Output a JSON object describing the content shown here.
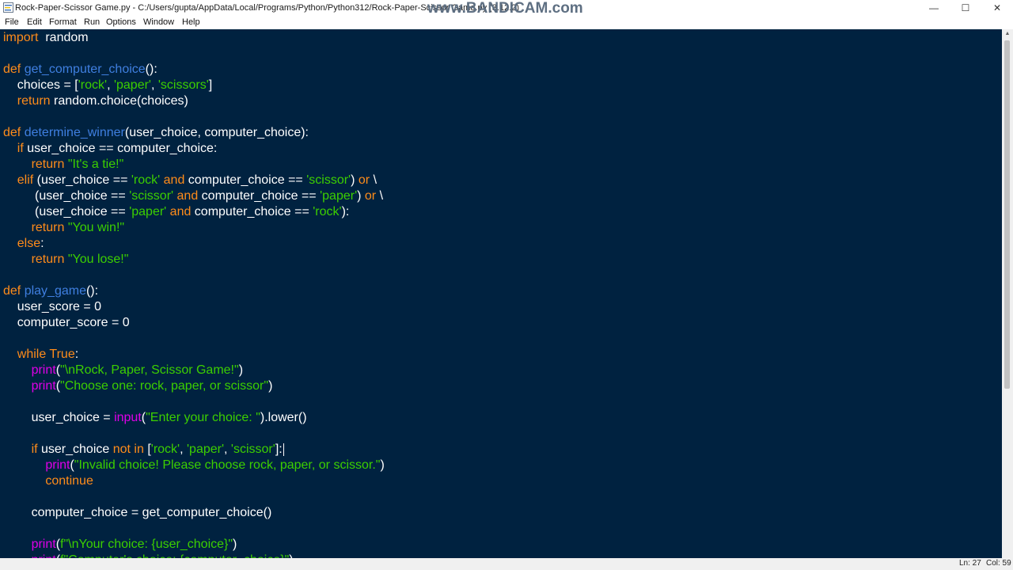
{
  "window": {
    "title": "Rock-Paper-Scissor Game.py - C:/Users/gupta/AppData/Local/Programs/Python/Python312/Rock-Paper-Scissor Game.py (3.12.2)",
    "watermark": "www.BANDICAM.com",
    "minimize_label": "—",
    "maximize_label": "☐",
    "close_label": "✕"
  },
  "menu": {
    "items": [
      {
        "label": "File"
      },
      {
        "label": "Edit"
      },
      {
        "label": "Format"
      },
      {
        "label": "Run"
      },
      {
        "label": "Options"
      },
      {
        "label": "Window"
      },
      {
        "label": "Help"
      }
    ]
  },
  "editor": {
    "colors": {
      "background": "#002240",
      "default": "#ffffff",
      "keyword": "#ff8c1a",
      "definition": "#3f7fe0",
      "string": "#3ccf00",
      "builtin": "#e000e8"
    },
    "lines": [
      [
        [
          "kw",
          "import"
        ],
        [
          "",
          "  random"
        ]
      ],
      [],
      [
        [
          "kw",
          "def "
        ],
        [
          "defn",
          "get_computer_choice"
        ],
        [
          "",
          "():"
        ]
      ],
      [
        [
          "",
          "    choices = ["
        ],
        [
          "str",
          "'rock'"
        ],
        [
          "",
          ", "
        ],
        [
          "str",
          "'paper'"
        ],
        [
          "",
          ", "
        ],
        [
          "str",
          "'scissors'"
        ],
        [
          "",
          "]"
        ]
      ],
      [
        [
          "kw",
          "    return"
        ],
        [
          "",
          " random.choice(choices)"
        ]
      ],
      [],
      [
        [
          "kw",
          "def "
        ],
        [
          "defn",
          "determine_winner"
        ],
        [
          "",
          "(user_choice, computer_choice):"
        ]
      ],
      [
        [
          "kw",
          "    if"
        ],
        [
          "",
          " user_choice == computer_choice:"
        ]
      ],
      [
        [
          "kw",
          "        return "
        ],
        [
          "str",
          "\"It's a tie!\""
        ]
      ],
      [
        [
          "kw",
          "    elif"
        ],
        [
          "",
          " (user_choice == "
        ],
        [
          "str",
          "'rock'"
        ],
        [
          "kw",
          " and"
        ],
        [
          "",
          " computer_choice == "
        ],
        [
          "str",
          "'scissor'"
        ],
        [
          "",
          ") "
        ],
        [
          "kw",
          "or"
        ],
        [
          "",
          " \\"
        ]
      ],
      [
        [
          "",
          "         (user_choice == "
        ],
        [
          "str",
          "'scissor'"
        ],
        [
          "kw",
          " and"
        ],
        [
          "",
          " computer_choice == "
        ],
        [
          "str",
          "'paper'"
        ],
        [
          "",
          ") "
        ],
        [
          "kw",
          "or"
        ],
        [
          "",
          " \\"
        ]
      ],
      [
        [
          "",
          "         (user_choice == "
        ],
        [
          "str",
          "'paper'"
        ],
        [
          "kw",
          " and"
        ],
        [
          "",
          " computer_choice == "
        ],
        [
          "str",
          "'rock'"
        ],
        [
          "",
          "):"
        ]
      ],
      [
        [
          "kw",
          "        return "
        ],
        [
          "str",
          "\"You win!\""
        ]
      ],
      [
        [
          "kw",
          "    else"
        ],
        [
          "",
          ":"
        ]
      ],
      [
        [
          "kw",
          "        return "
        ],
        [
          "str",
          "\"You lose!\""
        ]
      ],
      [],
      [
        [
          "kw",
          "def "
        ],
        [
          "defn",
          "play_game"
        ],
        [
          "",
          "():"
        ]
      ],
      [
        [
          "",
          "    user_score = 0"
        ]
      ],
      [
        [
          "",
          "    computer_score = 0"
        ]
      ],
      [],
      [
        [
          "kw",
          "    while"
        ],
        [
          "kw",
          " True"
        ],
        [
          "",
          ":"
        ]
      ],
      [
        [
          "bi",
          "        print"
        ],
        [
          "",
          "("
        ],
        [
          "str",
          "\"\\nRock, Paper, Scissor Game!\""
        ],
        [
          "",
          ")"
        ]
      ],
      [
        [
          "bi",
          "        print"
        ],
        [
          "",
          "("
        ],
        [
          "str",
          "\"Choose one: rock, paper, or scissor\""
        ],
        [
          "",
          ")"
        ]
      ],
      [],
      [
        [
          "",
          "        user_choice = "
        ],
        [
          "bi",
          "input"
        ],
        [
          "",
          "("
        ],
        [
          "str",
          "\"Enter your choice: \""
        ],
        [
          "",
          ").lower()"
        ]
      ],
      [],
      [
        [
          "kw",
          "        if"
        ],
        [
          "",
          " user_choice "
        ],
        [
          "kw",
          "not in"
        ],
        [
          "",
          " ["
        ],
        [
          "str",
          "'rock'"
        ],
        [
          "",
          ", "
        ],
        [
          "str",
          "'paper'"
        ],
        [
          "",
          ", "
        ],
        [
          "str",
          "'scissor'"
        ],
        [
          "",
          "]:"
        ]
      ],
      [
        [
          "bi",
          "            print"
        ],
        [
          "",
          "("
        ],
        [
          "str",
          "\"Invalid choice! Please choose rock, paper, or scissor.\""
        ],
        [
          "",
          ")"
        ]
      ],
      [
        [
          "kw",
          "            continue"
        ]
      ],
      [],
      [
        [
          "",
          "        computer_choice = get_computer_choice()"
        ]
      ],
      [],
      [
        [
          "bi",
          "        print"
        ],
        [
          "",
          "("
        ],
        [
          "str",
          "f\"\\nYour choice: {user_choice}\""
        ],
        [
          "",
          ")"
        ]
      ],
      [
        [
          "bi",
          "        print"
        ],
        [
          "",
          "("
        ],
        [
          "str",
          "f\"Computer's choice: {computer_choice}\""
        ],
        [
          "",
          ")"
        ]
      ]
    ],
    "cursor_line": 26
  },
  "status": {
    "line": "Ln: 27",
    "column": "Col: 59"
  }
}
